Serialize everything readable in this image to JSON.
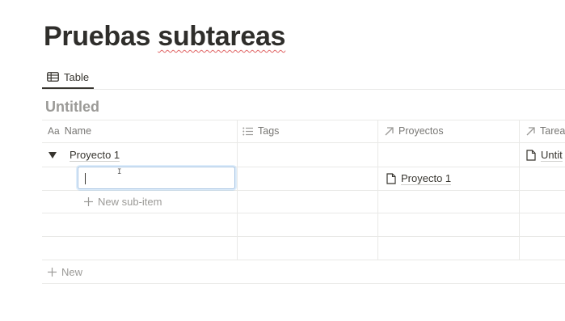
{
  "page": {
    "title_part1": "Pruebas",
    "title_part2": "subtareas"
  },
  "view": {
    "tab_label": "Table"
  },
  "database": {
    "title": "Untitled"
  },
  "columns": [
    {
      "label": "Name",
      "icon": "Aa"
    },
    {
      "label": "Tags",
      "icon": "list-icon"
    },
    {
      "label": "Proyectos",
      "icon": "arrow-up-right-icon"
    },
    {
      "label": "Tarea",
      "icon": "arrow-up-right-icon"
    }
  ],
  "rows": [
    {
      "name": "Proyecto 1",
      "tags": "",
      "proyectos": "",
      "tarea": "Untit"
    },
    {
      "name": "",
      "tags": "",
      "proyectos": "Proyecto 1",
      "tarea": ""
    }
  ],
  "new_sub_item_label": "New sub-item",
  "new_row_label": "New",
  "colors": {
    "text": "#37352f",
    "muted": "#9b9a97",
    "border": "#e9e9e7",
    "focus": "#a8c4e3",
    "spellcheck": "#e06565"
  }
}
